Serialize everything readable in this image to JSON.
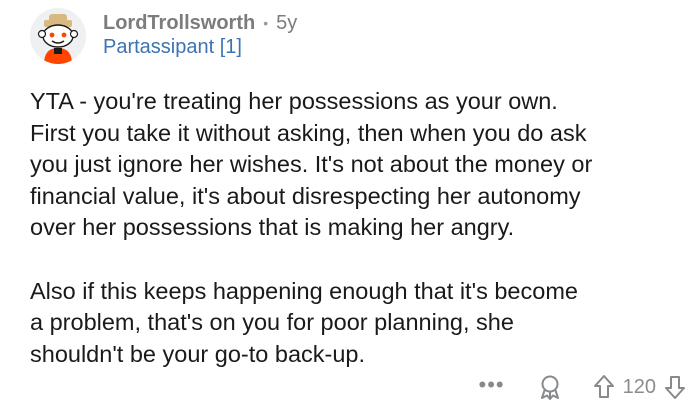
{
  "comment": {
    "author": "LordTrollsworth",
    "separator": "•",
    "age": "5y",
    "flair": "Partassipant [1]",
    "paragraph1_lines": [
      "YTA - you're treating her possessions as your own.",
      "First you take it without asking, then when you do ask",
      "you just ignore her wishes. It's not about the money or",
      "financial value, it's about disrespecting her autonomy",
      "over her possessions that is making her angry."
    ],
    "paragraph2_lines": [
      "Also if this keeps happening enough that it's become",
      "a problem, that's on you for poor planning, she",
      "shouldn't be your go-to back-up."
    ],
    "actions": {
      "more_label": "•••",
      "score": "120",
      "icons": [
        "avatar-icon",
        "more-icon",
        "award-icon",
        "upvote-icon",
        "downvote-icon"
      ]
    }
  },
  "colors": {
    "username": "#7c7c7c",
    "flair": "#3c73b2",
    "text": "#1a1a1b",
    "meta": "#878a8c",
    "avatar_orange": "#ff4500"
  }
}
